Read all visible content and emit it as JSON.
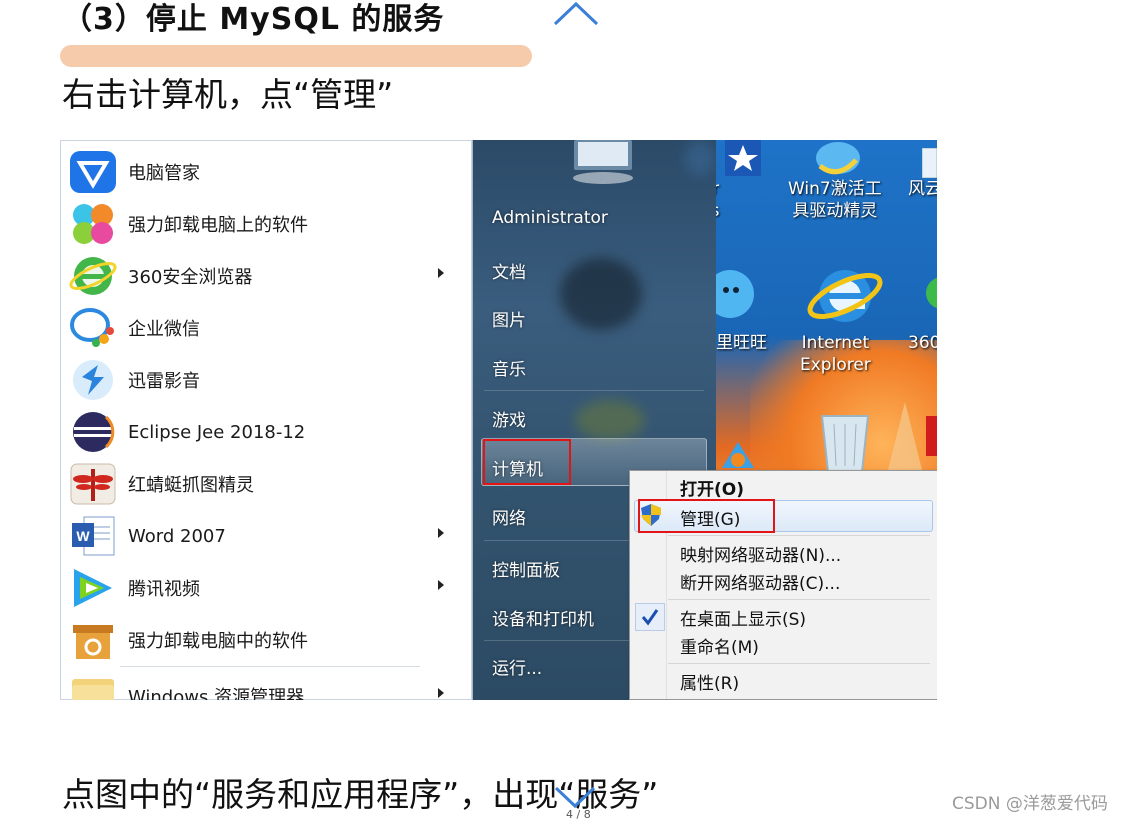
{
  "doc": {
    "heading_prefix": "（3）",
    "heading_text": "停止 MySQL 的服务",
    "para1": "右击计算机，点“管理”",
    "para2": "点图中的“服务和应用程序”，出现“服务”",
    "page_num": "4 / 8",
    "watermark": "CSDN @洋葱爱代码"
  },
  "start_menu": {
    "programs": [
      {
        "label": "电脑管家",
        "icon": "tencent-pc-manager-icon",
        "has_arrow": false
      },
      {
        "label": "强力卸载电脑上的软件",
        "icon": "uninstaller-icon",
        "has_arrow": false
      },
      {
        "label": "360安全浏览器",
        "icon": "360-browser-icon",
        "has_arrow": true
      },
      {
        "label": "企业微信",
        "icon": "wework-icon",
        "has_arrow": false
      },
      {
        "label": "迅雷影音",
        "icon": "xunlei-player-icon",
        "has_arrow": false
      },
      {
        "label": "Eclipse Jee 2018-12",
        "icon": "eclipse-icon",
        "has_arrow": false
      },
      {
        "label": "红蜻蜓抓图精灵",
        "icon": "dragonfly-capture-icon",
        "has_arrow": false
      },
      {
        "label": "Word 2007",
        "icon": "word-icon",
        "has_arrow": true
      },
      {
        "label": "腾讯视频",
        "icon": "tencent-video-icon",
        "has_arrow": true
      },
      {
        "label": "强力卸载电脑中的软件",
        "icon": "uninstall-box-icon",
        "has_arrow": false
      },
      {
        "label": "Windows 资源管理器",
        "icon": "explorer-folder-icon",
        "has_arrow": true
      }
    ],
    "right_items": {
      "user": "Administrator",
      "documents": "文档",
      "pictures": "图片",
      "music": "音乐",
      "games": "游戏",
      "computer": "计算机",
      "network": "网络",
      "control_panel": "控制面板",
      "devices": "设备和打印机",
      "run": "运行..."
    }
  },
  "context_menu": {
    "open": "打开(O)",
    "manage": "管理(G)",
    "map_drive": "映射网络驱动器(N)...",
    "disconnect_drive": "断开网络驱动器(C)...",
    "show_desktop": "在桌面上显示(S)",
    "rename": "重命名(M)",
    "properties": "属性(R)"
  },
  "desktop": {
    "icon1_line1": "ther",
    "icon1_line2": "ities",
    "icon2_line1": "Win7激活工",
    "icon2_line2": "具驱动精灵",
    "icon3": "风云",
    "icon4": "里旺旺",
    "icon5_line1": "Internet",
    "icon5_line2": "Explorer",
    "icon6": "360"
  },
  "colors": {
    "highlight": "#f6c8a8",
    "red_box": "#e21414",
    "menu_dark": "#33546f"
  }
}
